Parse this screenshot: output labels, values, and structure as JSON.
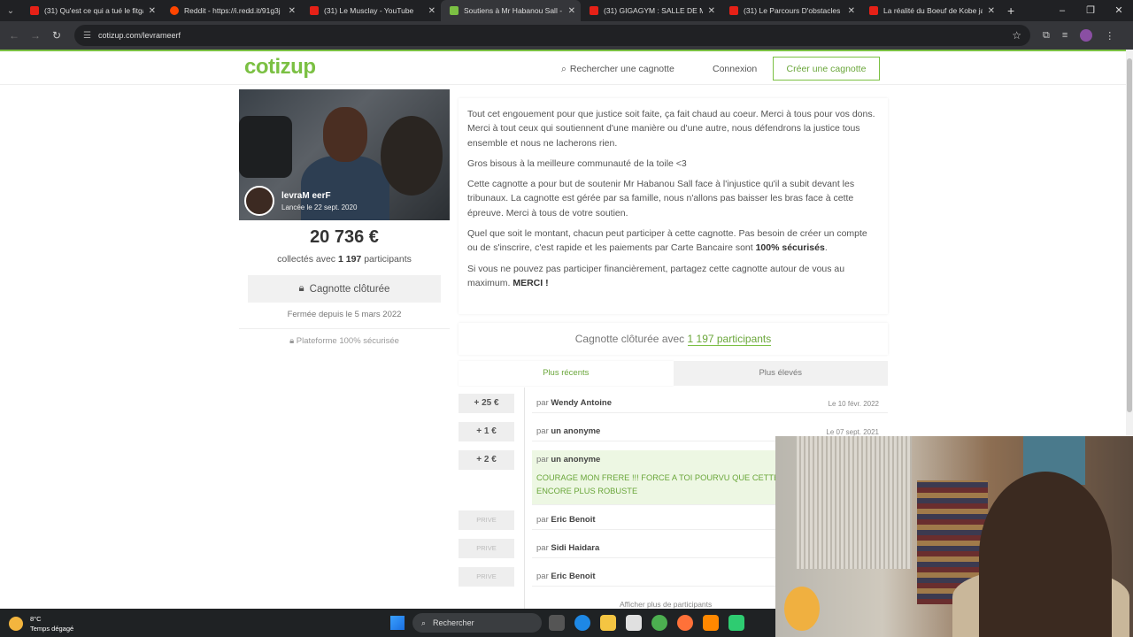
{
  "browser": {
    "tabs": [
      {
        "title": "(31) Qu'est ce qui a tué le fitgam",
        "icon": "youtube-icon"
      },
      {
        "title": "Reddit - https://i.redd.it/91g3j",
        "icon": "reddit-icon"
      },
      {
        "title": "(31) Le Musclay - YouTube",
        "icon": "youtube-icon"
      },
      {
        "title": "Soutiens à Mr Habanou Sall - ",
        "icon": "cotizup-icon",
        "active": true
      },
      {
        "title": "(31) GIGAGYM : SALLE DE MUS",
        "icon": "youtube-icon"
      },
      {
        "title": "(31) Le Parcours D'obstacles Le",
        "icon": "youtube-icon"
      },
      {
        "title": "La réalité du Boeuf de Kobe jap",
        "icon": "youtube-icon"
      }
    ],
    "url": "cotizup.com/levrameerf"
  },
  "header": {
    "logo": "cotizup",
    "search_label": "Rechercher une cagnotte",
    "login_label": "Connexion",
    "create_label": "Créer une cagnotte"
  },
  "campaign": {
    "creator": "levraM eerF",
    "launched": "Lancée le 22 sept. 2020",
    "amount": "20 736 €",
    "collected_prefix": "collectés avec",
    "participants_count": "1 197",
    "participants_word": "participants",
    "closed_button": "Cagnotte clôturée",
    "closed_since": "Fermée depuis le 5 mars 2022",
    "secure_note": "Plateforme 100% sécurisée"
  },
  "description": {
    "p1": "Tout cet engouement pour que justice soit faite, ça fait chaud au coeur. Merci à tous pour vos dons. Merci à tout ceux qui soutiennent d'une manière ou d'une autre, nous défendrons la justice tous ensemble et nous ne lacherons rien.",
    "p2": "Gros bisous à la meilleure communauté de la toile <3",
    "p3": "Cette cagnotte a pour but de soutenir Mr Habanou Sall face à l'injustice qu'il a subit devant les tribunaux. La cagnotte est gérée par sa famille, nous n'allons pas baisser les bras face à cette épreuve. Merci à tous de votre soutien.",
    "p4_start": "Quel que soit le montant, chacun peut participer à cette cagnotte. Pas besoin de créer un compte ou de s'inscrire, c'est rapide et les paiements par Carte Bancaire sont ",
    "p4_bold": "100% sécurisés",
    "p4_end": ".",
    "p5_start": "Si vous ne pouvez pas participer financièrement, partagez cette cagnotte autour de vous au maximum. ",
    "p5_bold": "MERCI !"
  },
  "participants": {
    "closed_with": "Cagnotte clôturée avec",
    "count_label": "1 197 participants",
    "tab_recent": "Plus récents",
    "tab_highest": "Plus élevés",
    "by": "par",
    "donations": [
      {
        "amount": "+ 25 €",
        "name": "Wendy Antoine",
        "date": "Le 10 févr. 2022"
      },
      {
        "amount": "+ 1 €",
        "name": "un anonyme",
        "date": "Le 07 sept. 2021"
      },
      {
        "amount": "+ 2 €",
        "name": "un anonyme",
        "message": "COURAGE MON FRERE !!! FORCE A TOI POURVU QUE CETTE ENCORE PLUS ROBUSTE"
      },
      {
        "amount": "PRIVE",
        "name": "Eric Benoit"
      },
      {
        "amount": "PRIVE",
        "name": "Sidi Haidara"
      },
      {
        "amount": "PRIVE",
        "name": "Eric Benoit"
      }
    ],
    "show_more": "Afficher plus de participants"
  },
  "taskbar": {
    "temp": "8°C",
    "weather": "Temps dégagé",
    "search": "Rechercher"
  }
}
